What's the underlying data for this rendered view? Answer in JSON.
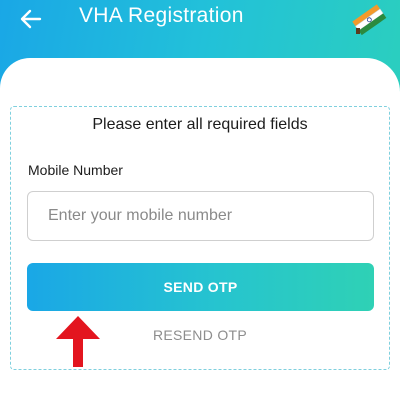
{
  "header": {
    "title": "VHA Registration",
    "back_icon": "back-arrow-icon",
    "flag_icon": "india-flag-icon"
  },
  "form": {
    "heading": "Please enter all required fields",
    "mobile_label": "Mobile Number",
    "mobile_placeholder": "Enter your mobile number",
    "mobile_value": "",
    "send_otp_label": "SEND OTP",
    "resend_otp_label": "RESEND OTP"
  },
  "annotation": {
    "pointer_icon": "red-up-arrow-icon",
    "color": "#e3151f"
  },
  "colors": {
    "gradient_start": "#1aa7e6",
    "gradient_end": "#2dd2b8",
    "resend_text": "#8d8d8d"
  }
}
